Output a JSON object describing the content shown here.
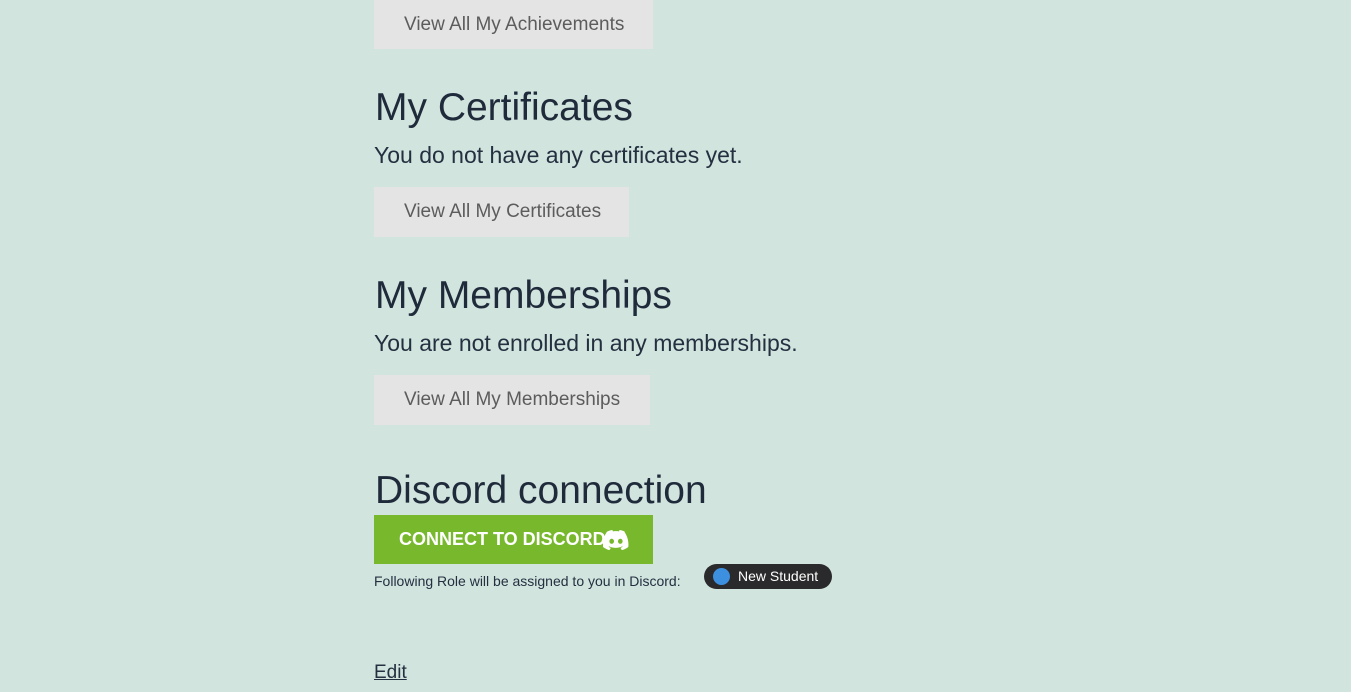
{
  "achievements": {
    "button_label": "View All My Achievements"
  },
  "certificates": {
    "heading": "My Certificates",
    "note": "You do not have any certificates yet.",
    "button_label": "View All My Certificates"
  },
  "memberships": {
    "heading": "My Memberships",
    "note": "You are not enrolled in any memberships.",
    "button_label": "View All My Memberships"
  },
  "discord": {
    "heading": "Discord connection",
    "button_label": "CONNECT TO DISCORD",
    "button_icon": "discord-icon",
    "role_text": "Following Role will be assigned to you in Discord:",
    "role_name": "New Student",
    "role_color": "#3d8fe0",
    "button_color": "#78b82d"
  },
  "edit_link": "Edit"
}
